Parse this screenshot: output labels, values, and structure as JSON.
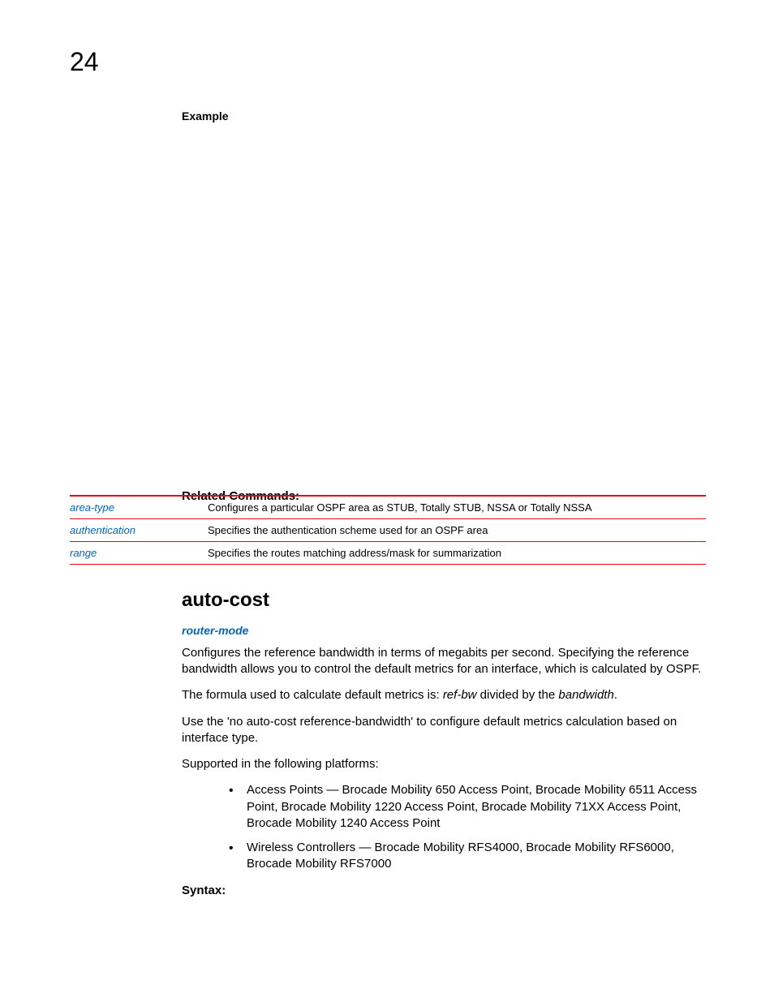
{
  "page_number": "24",
  "example_label": "Example",
  "related_commands_label": "Related Commands:",
  "related_commands": [
    {
      "name": "area-type",
      "desc": "Configures a particular OSPF area as STUB, Totally STUB, NSSA or Totally NSSA"
    },
    {
      "name": "authentication",
      "desc": "Specifies the authentication scheme used for an OSPF area"
    },
    {
      "name": "range",
      "desc": "Specifies the routes matching address/mask for summarization"
    }
  ],
  "section_title": "auto-cost",
  "router_mode_label": "router-mode",
  "para1": "Configures the reference bandwidth in terms of megabits per second. Specifying the reference bandwidth allows you to control the default metrics for an interface, which is calculated by OSPF.",
  "para2_pre": "The formula used to calculate default metrics is: ",
  "para2_i1": "ref-bw",
  "para2_mid": " divided by the ",
  "para2_i2": "bandwidth",
  "para2_post": ".",
  "para3": "Use the 'no auto-cost reference-bandwidth' to configure default metrics calculation based on interface type.",
  "supported_label": "Supported in the following platforms:",
  "bullets": [
    "Access Points — Brocade Mobility 650 Access Point, Brocade Mobility 6511 Access Point, Brocade Mobility 1220 Access Point, Brocade Mobility 71XX Access Point, Brocade Mobility 1240 Access Point",
    "Wireless Controllers — Brocade Mobility RFS4000, Brocade Mobility RFS6000, Brocade Mobility RFS7000"
  ],
  "syntax_label": "Syntax:"
}
